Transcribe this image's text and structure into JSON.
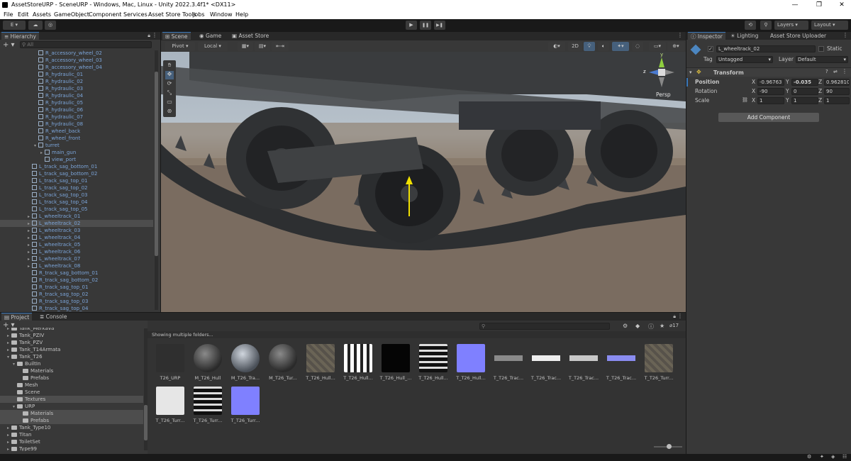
{
  "window": {
    "title": "AssetStoreURP - SceneURP - Windows, Mac, Linux - Unity 2022.3.4f1* <DX11>",
    "controls": [
      "—",
      "❐",
      "✕"
    ]
  },
  "menu": [
    "File",
    "Edit",
    "Assets",
    "GameObject",
    "Component",
    "Services",
    "Asset Store Tools",
    "Jobs",
    "Window",
    "Help"
  ],
  "toolbar": {
    "account_label": "E ▾",
    "play": "▶",
    "pause": "❚❚",
    "step": "▶❚",
    "layers_label": "Layers",
    "layout_label": "Layout"
  },
  "hierarchy": {
    "tab": "Hierarchy",
    "search_placeholder": "All",
    "items": [
      {
        "label": "R_accessory_wheel_02",
        "indent": 4
      },
      {
        "label": "R_accessory_wheel_03",
        "indent": 4
      },
      {
        "label": "R_accessory_wheel_04",
        "indent": 4
      },
      {
        "label": "R_hydraulic_01",
        "indent": 4
      },
      {
        "label": "R_hydraulic_02",
        "indent": 4
      },
      {
        "label": "R_hydraulic_03",
        "indent": 4
      },
      {
        "label": "R_hydraulic_04",
        "indent": 4
      },
      {
        "label": "R_hydraulic_05",
        "indent": 4
      },
      {
        "label": "R_hydraulic_06",
        "indent": 4
      },
      {
        "label": "R_hydraulic_07",
        "indent": 4
      },
      {
        "label": "R_hydraulic_08",
        "indent": 4
      },
      {
        "label": "R_wheel_back",
        "indent": 4
      },
      {
        "label": "R_wheel_front",
        "indent": 4
      },
      {
        "label": "turret",
        "indent": 4,
        "expanded": true
      },
      {
        "label": "main_gun",
        "indent": 5,
        "collapsed": true
      },
      {
        "label": "view_port",
        "indent": 5
      },
      {
        "label": "L_track_sag_bottom_01",
        "indent": 3
      },
      {
        "label": "L_track_sag_bottom_02",
        "indent": 3
      },
      {
        "label": "L_track_sag_top_01",
        "indent": 3
      },
      {
        "label": "L_track_sag_top_02",
        "indent": 3
      },
      {
        "label": "L_track_sag_top_03",
        "indent": 3
      },
      {
        "label": "L_track_sag_top_04",
        "indent": 3
      },
      {
        "label": "L_track_sag_top_05",
        "indent": 3
      },
      {
        "label": "L_wheeltrack_01",
        "indent": 3,
        "collapsed": true
      },
      {
        "label": "L_wheeltrack_02",
        "indent": 3,
        "collapsed": true,
        "selected": true
      },
      {
        "label": "L_wheeltrack_03",
        "indent": 3,
        "collapsed": true
      },
      {
        "label": "L_wheeltrack_04",
        "indent": 3,
        "collapsed": true
      },
      {
        "label": "L_wheeltrack_05",
        "indent": 3,
        "collapsed": true
      },
      {
        "label": "L_wheeltrack_06",
        "indent": 3,
        "collapsed": true
      },
      {
        "label": "L_wheeltrack_07",
        "indent": 3,
        "collapsed": true
      },
      {
        "label": "L_wheeltrack_08",
        "indent": 3,
        "collapsed": true
      },
      {
        "label": "R_track_sag_bottom_01",
        "indent": 3
      },
      {
        "label": "R_track_sag_bottom_02",
        "indent": 3
      },
      {
        "label": "R_track_sag_top_01",
        "indent": 3
      },
      {
        "label": "R_track_sag_top_02",
        "indent": 3
      },
      {
        "label": "R_track_sag_top_03",
        "indent": 3
      },
      {
        "label": "R_track_sag_top_04",
        "indent": 3
      }
    ]
  },
  "scene": {
    "tabs": [
      "Scene",
      "Game",
      "Asset Store"
    ],
    "pivot_label": "Pivot",
    "local_label": "Local",
    "mode_2d": "2D",
    "persp_label": "Persp",
    "gizmo_axes": {
      "y": "y",
      "z": "z",
      "x": "x"
    }
  },
  "inspector": {
    "tabs": [
      "Inspector",
      "Lighting",
      "Asset Store Uploader"
    ],
    "object_name": "L_wheeltrack_02",
    "static_label": "Static",
    "tag_label": "Tag",
    "tag_value": "Untagged",
    "layer_label": "Layer",
    "layer_value": "Default",
    "transform_title": "Transform",
    "position_label": "Position",
    "rotation_label": "Rotation",
    "scale_label": "Scale",
    "position": {
      "x": "-0.96763",
      "y": "-0.035",
      "z": "0.962810"
    },
    "rotation": {
      "x": "-90",
      "y": "0",
      "z": "90"
    },
    "scale": {
      "x": "1",
      "y": "1",
      "z": "1"
    },
    "add_component": "Add Component"
  },
  "project": {
    "tabs": [
      "Project",
      "Console"
    ],
    "tree": [
      {
        "label": "Tank_Merkava",
        "indent": 1,
        "collapsed": true
      },
      {
        "label": "Tank_PZIV",
        "indent": 1,
        "collapsed": true
      },
      {
        "label": "Tank_PZV",
        "indent": 1,
        "collapsed": true
      },
      {
        "label": "Tank_T14Armata",
        "indent": 1,
        "collapsed": true
      },
      {
        "label": "Tank_T26",
        "indent": 1,
        "expanded": true
      },
      {
        "label": "BuiltIn",
        "indent": 2,
        "expanded": true
      },
      {
        "label": "Materials",
        "indent": 3
      },
      {
        "label": "Prefabs",
        "indent": 3
      },
      {
        "label": "Mesh",
        "indent": 2
      },
      {
        "label": "Scene",
        "indent": 2
      },
      {
        "label": "Textures",
        "indent": 2,
        "selected": true
      },
      {
        "label": "URP",
        "indent": 2,
        "expanded": true
      },
      {
        "label": "Materials",
        "indent": 3,
        "selected": true
      },
      {
        "label": "Prefabs",
        "indent": 3,
        "selected": true
      },
      {
        "label": "Tank_Type10",
        "indent": 1,
        "collapsed": true
      },
      {
        "label": "Titan",
        "indent": 1,
        "collapsed": true
      },
      {
        "label": "ToiletSet",
        "indent": 1,
        "collapsed": true
      },
      {
        "label": "Type99",
        "indent": 1,
        "collapsed": true
      }
    ],
    "status_text": "Showing multiple folders...",
    "hidden_count": "17",
    "assets": [
      {
        "label": "T26_URP",
        "kind": "model"
      },
      {
        "label": "M_T26_Hull",
        "kind": "sphere-dark"
      },
      {
        "label": "M_T26_Tra...",
        "kind": "sphere-light"
      },
      {
        "label": "M_T26_Tur...",
        "kind": "sphere-dark"
      },
      {
        "label": "T_T26_Hull...",
        "kind": "tex-color"
      },
      {
        "label": "T_T26_Hull...",
        "kind": "tex-bw"
      },
      {
        "label": "T_T26_Hull_...",
        "kind": "tex-black"
      },
      {
        "label": "T_T26_Hull...",
        "kind": "tex-bw2"
      },
      {
        "label": "T_T26_Hull...",
        "kind": "tex-normal"
      },
      {
        "label": "T_T26_Trac...",
        "kind": "strip-gray"
      },
      {
        "label": "T_T26_Trac...",
        "kind": "strip-white"
      },
      {
        "label": "T_T26_Trac...",
        "kind": "strip-mix"
      },
      {
        "label": "T_T26_Trac...",
        "kind": "strip-blue"
      },
      {
        "label": "T_T26_Turr...",
        "kind": "tex-color"
      },
      {
        "label": "T_T26_Turr...",
        "kind": "tex-white"
      },
      {
        "label": "T_T26_Turr...",
        "kind": "tex-bw2"
      },
      {
        "label": "T_T26_Turr...",
        "kind": "tex-normal"
      }
    ]
  },
  "colors": {
    "accent": "#3a79bb",
    "selection": "#2c5d87",
    "panel": "#383838",
    "dark": "#191919",
    "hierarchy_blue": "#7ba4d8"
  }
}
